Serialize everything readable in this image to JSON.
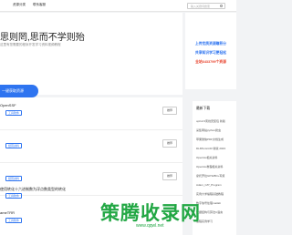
{
  "nav": {
    "item1": "资源分类",
    "item2": "联系客服",
    "search_placeholder": "输入关键词搜索"
  },
  "hero": {
    "title": "思则罔,思而不学则殆",
    "subtitle": "这里有您需要的程序开发学习资料视频教程",
    "button_label": "一键获取资源"
  },
  "promo": {
    "line1": "上传优质资源赚积分",
    "line2": "共享知识学习更轻松",
    "line3": "全站6433799个资源"
  },
  "list": {
    "items": [
      {
        "title": "OpenSSF",
        "tag": "工具软件",
        "button": "推荐"
      },
      {
        "title": "",
        "tag": "经营资料",
        "button": "推荐"
      },
      {
        "title": "",
        "tag": "经营资料",
        "button": "推荐"
      },
      {
        "title": "使用转化十六进制数为浮点数类型的转化",
        "tag": "工具软件",
        "button": "推荐"
      },
      {
        "title": "ameTRR",
        "tag": "工具软件",
        "button": "推荐"
      }
    ]
  },
  "side": {
    "heading": "最新下载",
    "items": [
      "opt12.0离线安装包 新版",
      "采集网站python爬虫",
      "苹果微信PDF文档生成",
      "DLMS-GnCR 新版 2023",
      "OpenGL相关资料",
      "OpenGL教程相关资料",
      "摩托罗拉GP328D+写频",
      "Adam_C/P_Program",
      "实例大学编程基础教程",
      "数字信号处理matlab",
      "数据结构与算法C语言",
      "编程实例学习"
    ]
  },
  "watermark": {
    "text": "策腾收录网",
    "url": "www.qqwl.net"
  }
}
